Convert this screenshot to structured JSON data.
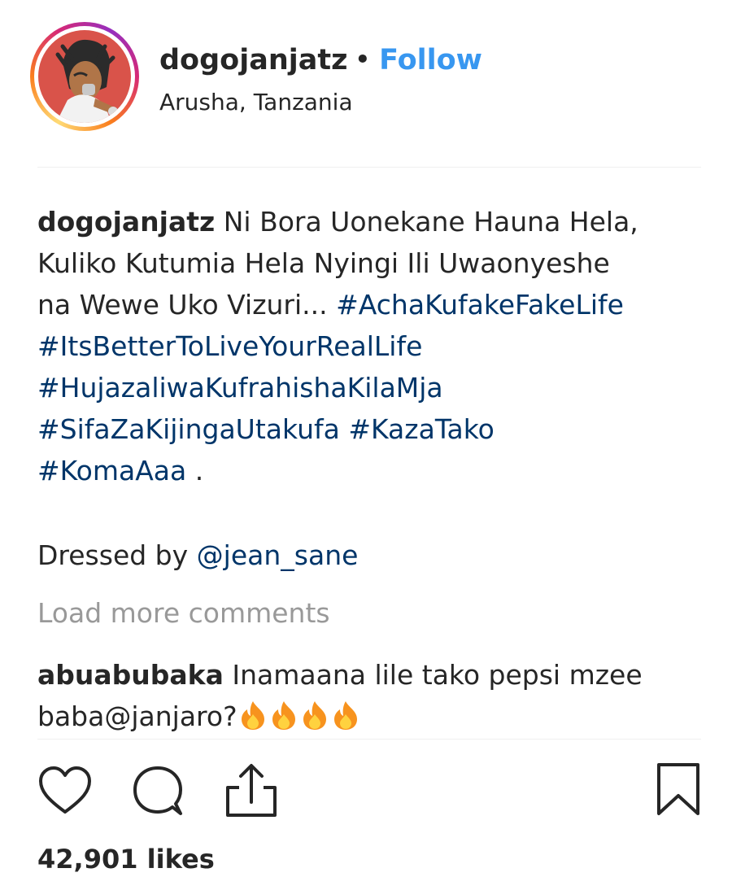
{
  "post": {
    "username": "dogojanjatz",
    "separator": "•",
    "follow_label": "Follow",
    "location": "Arusha, Tanzania"
  },
  "caption": {
    "username": "dogojanjatz",
    "text_line1": "Ni Bora Uonekane Hauna Hela,",
    "text_line2": "Kuliko Kutumia Hela Nyingi Ili Uwaonyeshe",
    "text_line3": "na Wewe Uko Vizuri...",
    "hashtags": [
      "#AchaKufakeFakeLife",
      "#ItsBetterToLiveYourRealLife",
      "#HujazaliwaKufrahishaKilaMja",
      "#SifaZaKijingaUtakufa",
      "#KazaTako",
      "#KomaAaa"
    ],
    "trailing": ".",
    "credit_prefix": "Dressed by",
    "credit_mention": "@jean_sane"
  },
  "load_more_label": "Load more comments",
  "comment": {
    "username": "abuabubaka",
    "text_line1": "Inamaana lile tako pepsi mzee",
    "text_line2": "baba@janjaro?",
    "emoji_name": "fire-emoji",
    "emoji_count": 4
  },
  "actions": {
    "like_icon": "heart-icon",
    "comment_icon": "comment-bubble-icon",
    "share_icon": "share-icon",
    "save_icon": "bookmark-icon"
  },
  "likes_text": "42,901 likes",
  "colors": {
    "text": "#262626",
    "follow": "#3897f0",
    "hashtag": "#003569",
    "muted": "#999999",
    "divider": "#efefef"
  }
}
